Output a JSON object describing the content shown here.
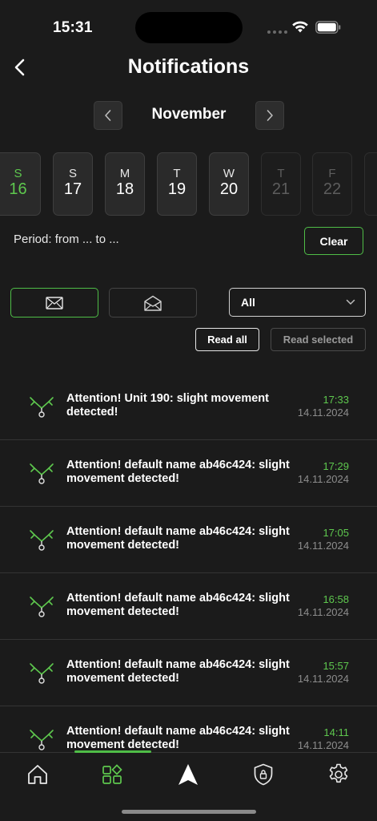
{
  "status_bar": {
    "time": "15:31"
  },
  "header": {
    "title": "Notifications"
  },
  "month": {
    "label": "November"
  },
  "days": [
    {
      "dow": "S",
      "num": "16",
      "state": "selected"
    },
    {
      "dow": "S",
      "num": "17",
      "state": "normal"
    },
    {
      "dow": "M",
      "num": "18",
      "state": "normal"
    },
    {
      "dow": "T",
      "num": "19",
      "state": "normal"
    },
    {
      "dow": "W",
      "num": "20",
      "state": "normal"
    },
    {
      "dow": "T",
      "num": "21",
      "state": "disabled"
    },
    {
      "dow": "F",
      "num": "22",
      "state": "disabled"
    }
  ],
  "period": {
    "text": "Period: from ... to ...",
    "clear_label": "Clear"
  },
  "filters": {
    "select_value": "All"
  },
  "actions": {
    "read_all_label": "Read all",
    "read_selected_label": "Read selected"
  },
  "notifications": [
    {
      "text": "Attention! Unit 190: slight movement detected!",
      "time": "17:33",
      "date": "14.11.2024"
    },
    {
      "text": "Attention! default name ab46c424: slight movement detected!",
      "time": "17:29",
      "date": "14.11.2024"
    },
    {
      "text": "Attention! default name ab46c424: slight movement detected!",
      "time": "17:05",
      "date": "14.11.2024"
    },
    {
      "text": "Attention! default name ab46c424: slight movement detected!",
      "time": "16:58",
      "date": "14.11.2024"
    },
    {
      "text": "Attention! default name ab46c424: slight movement detected!",
      "time": "15:57",
      "date": "14.11.2024"
    },
    {
      "text": "Attention! default name ab46c424: slight movement detected!",
      "time": "14:11",
      "date": "14.11.2024"
    }
  ],
  "tabs": [
    {
      "name": "home",
      "icon": "home-icon"
    },
    {
      "name": "devices",
      "icon": "grid-icon"
    },
    {
      "name": "navigation",
      "icon": "navigation-arrow-icon"
    },
    {
      "name": "security",
      "icon": "shield-lock-icon"
    },
    {
      "name": "settings",
      "icon": "gear-icon"
    }
  ],
  "colors": {
    "accent": "#5ec84e",
    "background": "#1b1b1b",
    "muted": "#8d8d8d"
  }
}
